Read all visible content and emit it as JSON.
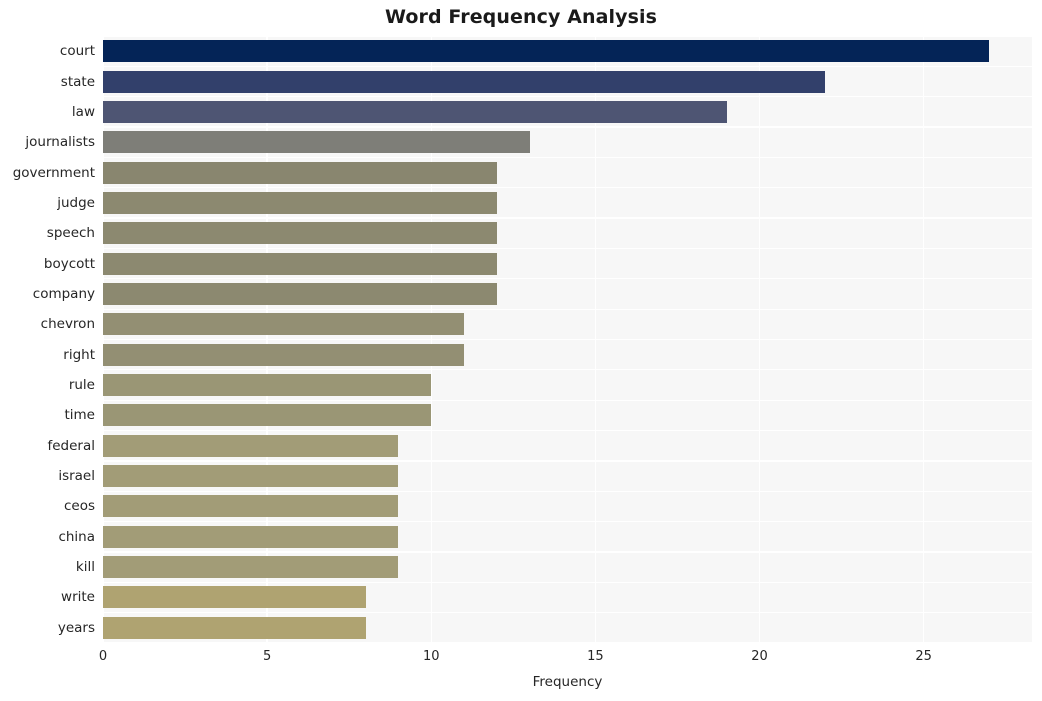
{
  "chart_data": {
    "type": "bar",
    "orientation": "horizontal",
    "title": "Word Frequency Analysis",
    "xlabel": "Frequency",
    "ylabel": "",
    "categories": [
      "court",
      "state",
      "law",
      "journalists",
      "government",
      "judge",
      "speech",
      "boycott",
      "company",
      "chevron",
      "right",
      "rule",
      "time",
      "federal",
      "israel",
      "ceos",
      "china",
      "kill",
      "write",
      "years"
    ],
    "values": [
      27,
      22,
      19,
      13,
      12,
      12,
      12,
      12,
      12,
      11,
      11,
      10,
      10,
      9,
      9,
      9,
      9,
      9,
      8,
      8
    ],
    "bar_colors": [
      "#042457",
      "#32406b",
      "#4e5573",
      "#7e7e78",
      "#89866f",
      "#8c8970",
      "#8c8970",
      "#8c8970",
      "#8c8970",
      "#938f73",
      "#938f73",
      "#9a9675",
      "#9a9675",
      "#a29c77",
      "#a29c77",
      "#a29c77",
      "#a29c77",
      "#a29c77",
      "#afa371",
      "#afa371"
    ],
    "xlim": [
      0,
      28.3
    ],
    "xticks": [
      0,
      5,
      10,
      15,
      20,
      25
    ],
    "xtick_labels": [
      "0",
      "5",
      "10",
      "15",
      "20",
      "25"
    ],
    "grid": true,
    "grid_color": "#ffffff",
    "plot_background": "#f7f7f7",
    "figure_background": "#ffffff",
    "legend": null,
    "style": "whitegrid"
  }
}
